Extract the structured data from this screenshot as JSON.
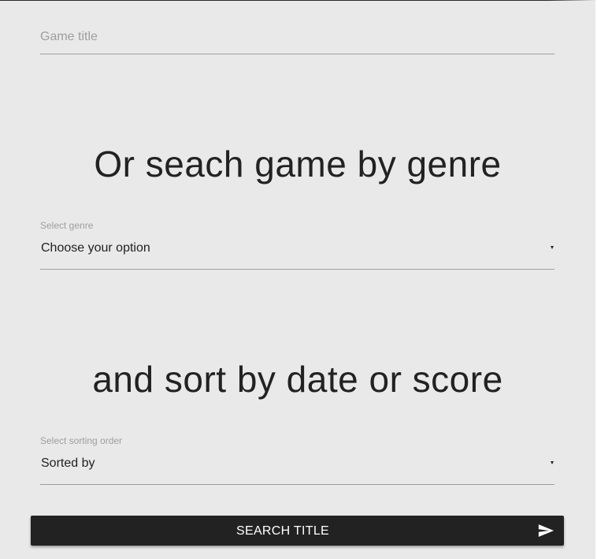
{
  "title_input": {
    "placeholder": "Game title",
    "value": ""
  },
  "genre_section": {
    "heading": "Or seach game by genre",
    "label": "Select genre",
    "selected": "Choose your option"
  },
  "sort_section": {
    "heading": "and sort by date or score",
    "label": "Select sorting order",
    "selected": "Sorted by"
  },
  "search_button": {
    "label": "SEARCH TITLE",
    "icon": "send-icon"
  },
  "colors": {
    "background": "#e9e9e9",
    "text": "#222222",
    "muted": "#9e9e9e",
    "button": "#222222",
    "button_text": "#ffffff"
  }
}
